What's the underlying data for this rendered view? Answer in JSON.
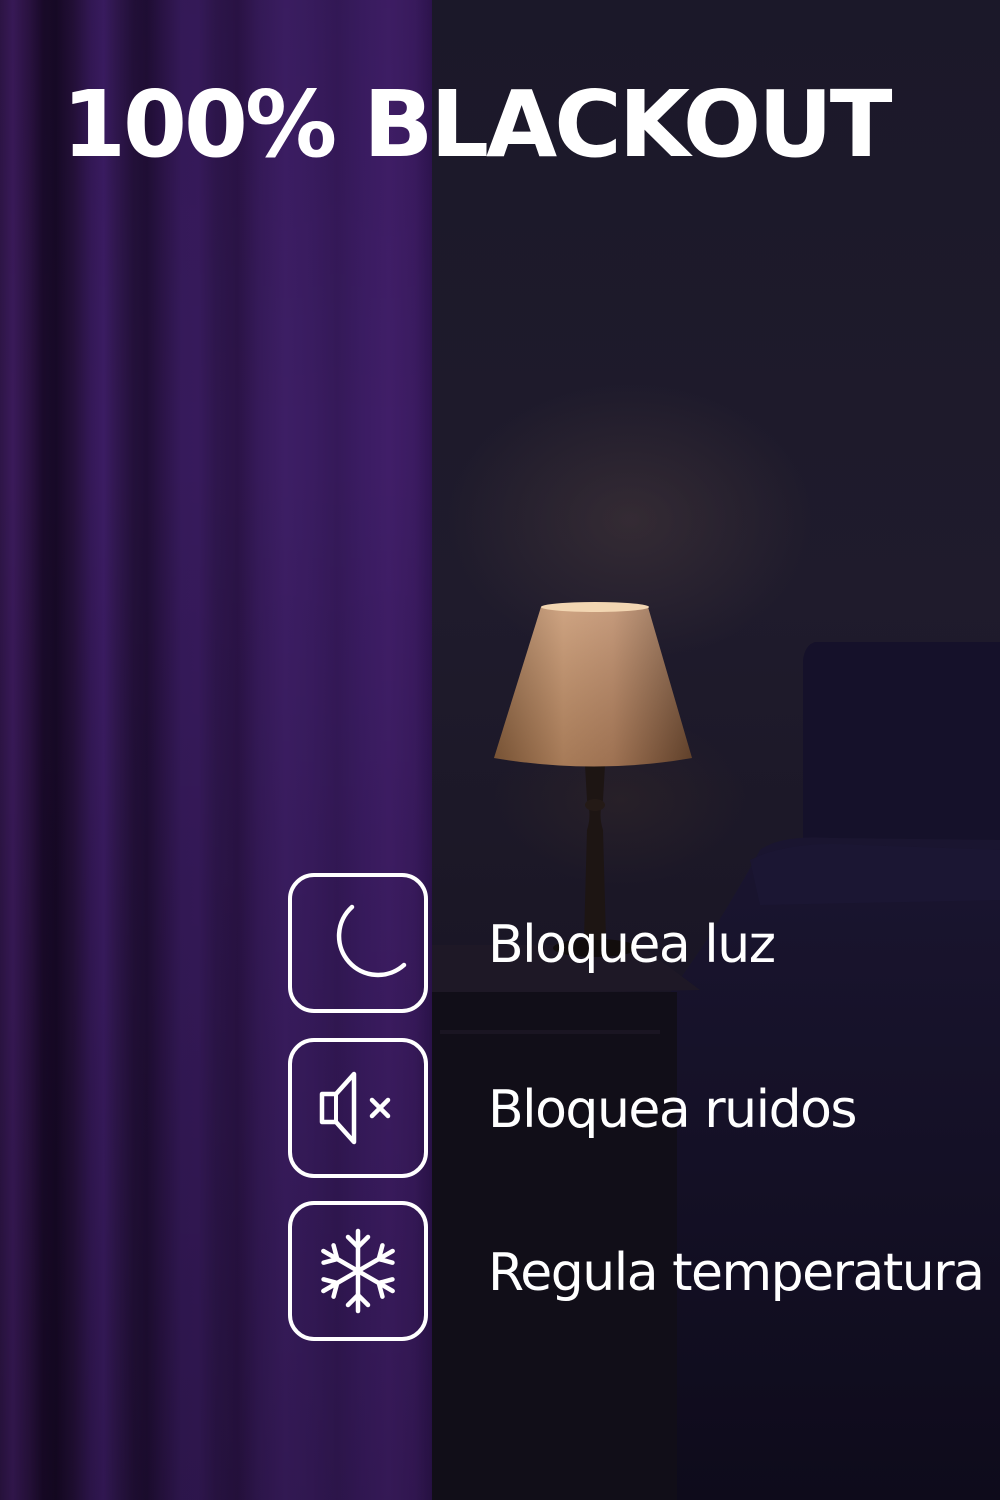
{
  "headline": "100% BLACKOUT",
  "colors": {
    "curtain": "#3a1c61",
    "room": "#1c1929",
    "lampshade": "#d9a878",
    "text": "#ffffff"
  },
  "features": [
    {
      "icon": "moon-icon",
      "label": "Bloquea luz"
    },
    {
      "icon": "speaker-muted-icon",
      "label": "Bloquea ruidos"
    },
    {
      "icon": "snowflake-icon",
      "label": "Regula temperatura"
    }
  ]
}
